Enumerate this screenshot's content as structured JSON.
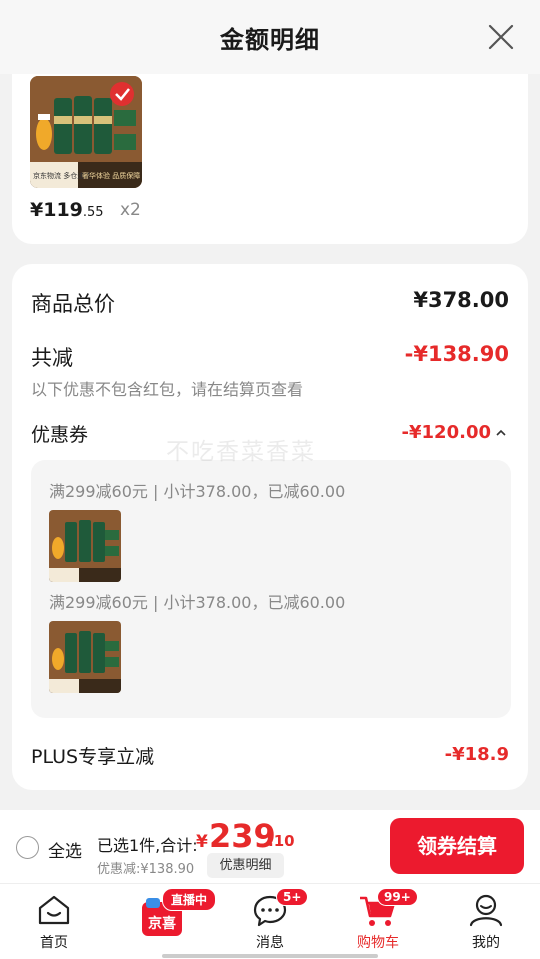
{
  "header": {
    "title": "金额明细"
  },
  "product": {
    "price_symbol": "¥",
    "price_int": "119",
    "price_dec": ".55",
    "qty": "x2",
    "img_caption_left": "京东物流 多仓速达",
    "img_caption_right": "奢华体验 品质保障"
  },
  "summary": {
    "total_label": "商品总价",
    "total_value": "¥378.00",
    "reduce_label": "共减",
    "reduce_value": "-¥138.90",
    "reduce_note": "以下优惠不包含红包，请在结算页查看",
    "coupon_label": "优惠券",
    "coupon_value": "-¥120.00",
    "coupon_lines": [
      "满299减60元 | 小计378.00，已减60.00",
      "满299减60元 | 小计378.00，已减60.00"
    ],
    "plus_label": "PLUS专享立减",
    "plus_value": "-¥18.9"
  },
  "watermark": "不吃香菜香菜",
  "checkout": {
    "select_all": "全选",
    "selected_text": "已选1件,合计:",
    "total_symbol": "¥",
    "total_int": "239",
    "total_dec": ".10",
    "discount_text": "优惠减:¥138.90",
    "detail_button": "优惠明细",
    "pay_button": "领券结算"
  },
  "tabbar": {
    "home": "首页",
    "live_badge": "直播中",
    "live_logo": "京喜",
    "messages": "消息",
    "messages_badge": "5+",
    "cart": "购物车",
    "cart_badge": "99+",
    "mine": "我的"
  },
  "colors": {
    "accent": "#e62a2a",
    "button": "#ec1a2e"
  }
}
